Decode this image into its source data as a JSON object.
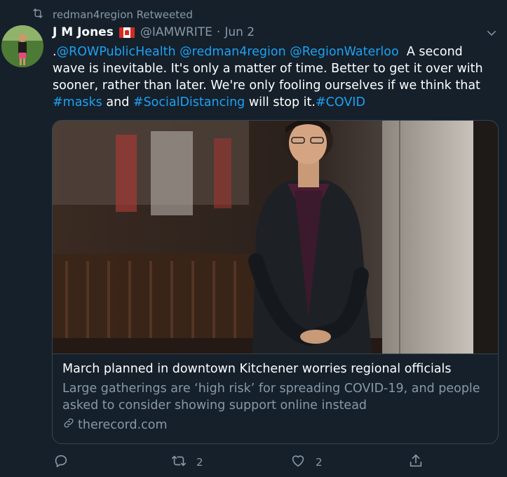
{
  "retweet_context": {
    "label": "redman4region Retweeted",
    "icon": "retweet-icon"
  },
  "author": {
    "name": "J M Jones",
    "handle": "@IAMWRITE",
    "separator": "·",
    "date": "Jun 2",
    "flag": "canada-flag"
  },
  "tweet": {
    "prefix": ".",
    "mention1": "@ROWPublicHealth",
    "mention2": "@redman4region",
    "mention3": "@RegionWaterloo",
    "text1": "A second wave is inevitable. It's only a matter of time. Better to get it over with sooner, rather than later. We're only fooling ourselves if we think that",
    "hashtag1": "#masks",
    "and": "and",
    "hashtag2": "#SocialDistancing",
    "text2": "will stop it.",
    "hashtag3": "#COVID"
  },
  "card": {
    "title": "March planned in downtown Kitchener worries regional officials",
    "description": "Large gatherings are ‘high risk’ for spreading COVID-19, and people asked to consider showing support online instead",
    "domain": "therecord.com"
  },
  "actions": {
    "reply_count": "",
    "retweet_count": "2",
    "like_count": "2"
  },
  "colors": {
    "background": "#15202b",
    "link": "#1da1f2",
    "muted": "#8899a6",
    "border": "#38444d"
  }
}
